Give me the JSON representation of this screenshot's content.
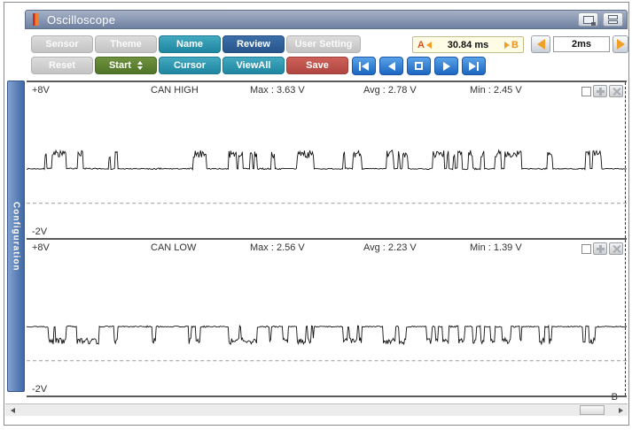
{
  "window": {
    "title": "Oscilloscope",
    "title_icon": "scope-probe-icon",
    "control_icons": [
      "cascade-window-icon",
      "stack-window-icon"
    ]
  },
  "toolbar": {
    "row1": [
      {
        "label": "Sensor"
      },
      {
        "label": "Theme"
      },
      {
        "label": "Name"
      },
      {
        "label": "Review"
      },
      {
        "label": "User Setting"
      }
    ],
    "row2": [
      {
        "label": "Reset"
      },
      {
        "label": "Start"
      },
      {
        "label": "Cursor"
      },
      {
        "label": "ViewAll"
      },
      {
        "label": "Save"
      }
    ],
    "playback_icons": [
      "skip-start",
      "step-back",
      "stop",
      "play",
      "skip-end"
    ],
    "ab_measure": {
      "a_label": "A",
      "value": "30.84 ms",
      "b_label": "B"
    },
    "timebase": {
      "value": "2ms"
    }
  },
  "sidebar": {
    "label": "Configuration"
  },
  "channels": [
    {
      "top_scale": "+8V",
      "name": "CAN HIGH",
      "max": "Max : 3.63 V",
      "avg": "Avg : 2.78 V",
      "min": "Min : 2.45 V",
      "bottom_scale": "-2V"
    },
    {
      "top_scale": "+8V",
      "name": "CAN LOW",
      "max": "Max : 2.56 V",
      "avg": "Avg : 2.23 V",
      "min": "Min : 1.39 V",
      "bottom_scale": "-2V",
      "cursor_label": "B"
    }
  ],
  "chart_data": [
    {
      "type": "line",
      "name": "CAN HIGH",
      "ylim": [
        -2,
        8
      ],
      "y_top_label": "+8V",
      "y_bottom_label": "-2V",
      "zero_gridline": 0,
      "baseline_v": 2.5,
      "active_v": 3.6,
      "stats": {
        "max_v": 3.63,
        "avg_v": 2.78,
        "min_v": 2.45
      },
      "seed": 7,
      "peak_jitter": 0.55,
      "bursts": [
        [
          0.028,
          0.121
        ],
        [
          0.137,
          0.152
        ],
        [
          0.199,
          0.224
        ],
        [
          0.27,
          0.301
        ],
        [
          0.337,
          0.435
        ],
        [
          0.45,
          0.478
        ],
        [
          0.528,
          0.558
        ],
        [
          0.594,
          0.636
        ],
        [
          0.666,
          0.763
        ],
        [
          0.773,
          0.825
        ],
        [
          0.855,
          0.876
        ],
        [
          0.927,
          0.958
        ]
      ]
    },
    {
      "type": "line",
      "name": "CAN LOW",
      "ylim": [
        -2,
        8
      ],
      "y_top_label": "+8V",
      "y_bottom_label": "-2V",
      "zero_gridline": 0,
      "baseline_v": 2.48,
      "active_v": 1.45,
      "stats": {
        "max_v": 2.56,
        "avg_v": 2.23,
        "min_v": 1.39
      },
      "seed": 13,
      "peak_jitter": 0.45,
      "bursts": [
        [
          0.028,
          0.121
        ],
        [
          0.137,
          0.152
        ],
        [
          0.199,
          0.224
        ],
        [
          0.27,
          0.301
        ],
        [
          0.337,
          0.435
        ],
        [
          0.45,
          0.478
        ],
        [
          0.528,
          0.558
        ],
        [
          0.594,
          0.636
        ],
        [
          0.666,
          0.763
        ],
        [
          0.773,
          0.825
        ],
        [
          0.855,
          0.876
        ],
        [
          0.927,
          0.958
        ]
      ]
    }
  ],
  "colors": {
    "titlebar_top": "#a6b1c6",
    "titlebar_bottom": "#6e80a1",
    "teal": "#2e95ad",
    "blue": "#2e6095",
    "green": "#5d8030",
    "red": "#c0544c",
    "gray_button": "#cccccc",
    "playback_blue": "#2277cc",
    "ab_bg": "#fffce6",
    "accent_orange": "#f0a028",
    "sidebar_blue": "#4a74b0",
    "trace": "#111111"
  }
}
